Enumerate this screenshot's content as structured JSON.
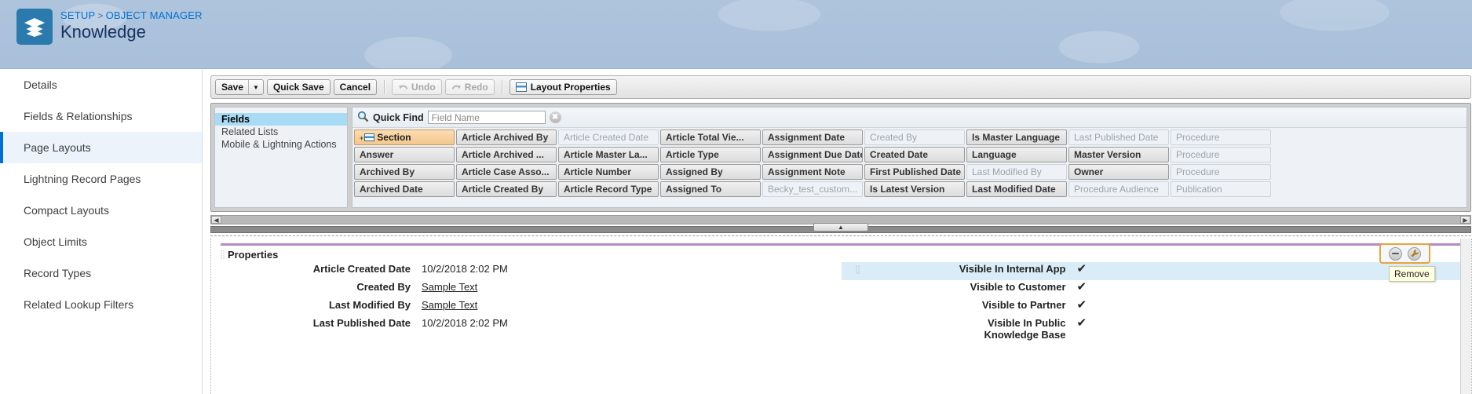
{
  "header": {
    "breadcrumb": {
      "setup": "SETUP",
      "separator": ">",
      "object_manager": "OBJECT MANAGER"
    },
    "title": "Knowledge",
    "icon": "layers-icon"
  },
  "sidebar": {
    "items": [
      {
        "label": "Details",
        "active": false
      },
      {
        "label": "Fields & Relationships",
        "active": false
      },
      {
        "label": "Page Layouts",
        "active": true
      },
      {
        "label": "Lightning Record Pages",
        "active": false
      },
      {
        "label": "Compact Layouts",
        "active": false
      },
      {
        "label": "Object Limits",
        "active": false
      },
      {
        "label": "Record Types",
        "active": false
      },
      {
        "label": "Related Lookup Filters",
        "active": false
      }
    ]
  },
  "toolbar": {
    "save_label": "Save",
    "save_caret": "▼",
    "quick_save_label": "Quick Save",
    "cancel_label": "Cancel",
    "undo_label": "Undo",
    "redo_label": "Redo",
    "layout_properties_label": "Layout Properties"
  },
  "palette": {
    "tabs": [
      {
        "label": "Fields",
        "active": true
      },
      {
        "label": "Related Lists",
        "active": false
      },
      {
        "label": "Mobile & Lightning Actions",
        "active": false
      }
    ],
    "quick_find": {
      "label": "Quick Find",
      "placeholder": "Field Name",
      "value": "",
      "clear_glyph": "✖"
    },
    "scroll_left_glyph": "◀",
    "scroll_right_glyph": "▶",
    "rows": [
      [
        {
          "label": "Section",
          "state": "section"
        },
        {
          "label": "Article Archived By",
          "state": "available"
        },
        {
          "label": "Article Created Date",
          "state": "used"
        },
        {
          "label": "Article Total Vie...",
          "state": "available"
        },
        {
          "label": "Assignment Date",
          "state": "available"
        },
        {
          "label": "Created By",
          "state": "used"
        },
        {
          "label": "Is Master Language",
          "state": "available"
        },
        {
          "label": "Last Published Date",
          "state": "used"
        },
        {
          "label": "Procedure",
          "state": "used"
        }
      ],
      [
        {
          "label": "Answer",
          "state": "available"
        },
        {
          "label": "Article Archived ...",
          "state": "available"
        },
        {
          "label": "Article Master La...",
          "state": "available"
        },
        {
          "label": "Article Type",
          "state": "available"
        },
        {
          "label": "Assignment Due Date",
          "state": "available"
        },
        {
          "label": "Created Date",
          "state": "available"
        },
        {
          "label": "Language",
          "state": "available"
        },
        {
          "label": "Master Version",
          "state": "available"
        },
        {
          "label": "Procedure",
          "state": "used"
        }
      ],
      [
        {
          "label": "Archived By",
          "state": "available"
        },
        {
          "label": "Article Case Asso...",
          "state": "available"
        },
        {
          "label": "Article Number",
          "state": "available"
        },
        {
          "label": "Assigned By",
          "state": "available"
        },
        {
          "label": "Assignment Note",
          "state": "available"
        },
        {
          "label": "First Published Date",
          "state": "available"
        },
        {
          "label": "Last Modified By",
          "state": "used"
        },
        {
          "label": "Owner",
          "state": "available"
        },
        {
          "label": "Procedure",
          "state": "used"
        }
      ],
      [
        {
          "label": "Archived Date",
          "state": "available"
        },
        {
          "label": "Article Created By",
          "state": "available"
        },
        {
          "label": "Article Record Type",
          "state": "available"
        },
        {
          "label": "Assigned To",
          "state": "available"
        },
        {
          "label": "Becky_test_custom...",
          "state": "used"
        },
        {
          "label": "Is Latest Version",
          "state": "available"
        },
        {
          "label": "Last Modified Date",
          "state": "available"
        },
        {
          "label": "Procedure Audience",
          "state": "used"
        },
        {
          "label": "Publication",
          "state": "used"
        }
      ]
    ]
  },
  "layout": {
    "section_title": "Properties",
    "left_rows": [
      {
        "label": "Article Created Date",
        "value": "10/2/2018 2:02 PM",
        "link": false
      },
      {
        "label": "Created By",
        "value": "Sample Text",
        "link": true
      },
      {
        "label": "Last Modified By",
        "value": "Sample Text",
        "link": true
      },
      {
        "label": "Last Published Date",
        "value": "10/2/2018 2:02 PM",
        "link": false
      }
    ],
    "right_rows": [
      {
        "label": "Visible In Internal App",
        "value": "✔",
        "highlight": true
      },
      {
        "label": "Visible to Customer",
        "value": "✔",
        "highlight": false
      },
      {
        "label": "Visible to Partner",
        "value": "✔",
        "highlight": false
      },
      {
        "label": "Visible In Public Knowledge Base",
        "value": "✔",
        "highlight": false
      }
    ],
    "hover_actions": {
      "remove_icon": "remove-circle-icon",
      "properties_icon": "wrench-icon",
      "tooltip": "Remove"
    }
  },
  "colors": {
    "accent": "#0070d2",
    "header_bg": "#aec4dd",
    "section_rule": "#b48bc4",
    "highlight_row": "#d9ecf7",
    "tooltip_bg": "#ffffe1",
    "focus_ring": "#e8a33d"
  }
}
